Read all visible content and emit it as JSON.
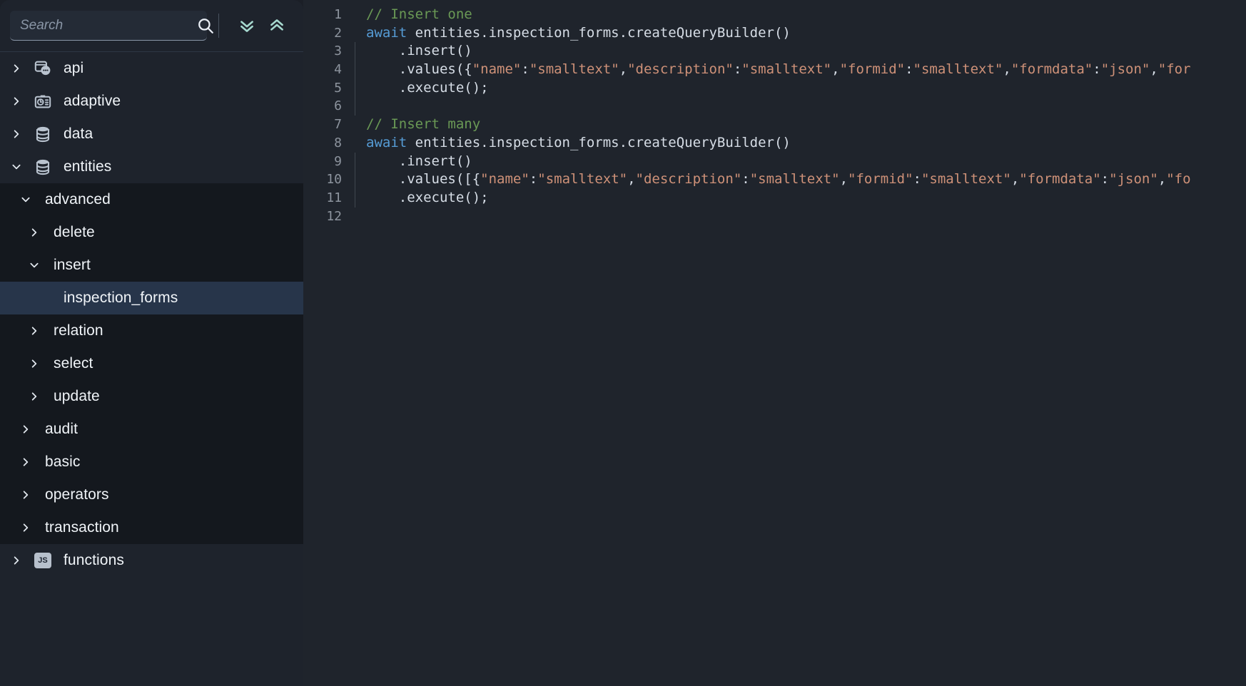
{
  "sidebar": {
    "search": {
      "placeholder": "Search",
      "value": "",
      "icon": "search-icon"
    },
    "expand_all_label": "Expand all",
    "collapse_all_label": "Collapse all",
    "tree": [
      {
        "label": "api",
        "depth": 0,
        "icon": "api-icon",
        "state": "collapsed",
        "selected": false
      },
      {
        "label": "adaptive",
        "depth": 0,
        "icon": "adaptive-icon",
        "state": "collapsed",
        "selected": false
      },
      {
        "label": "data",
        "depth": 0,
        "icon": "database-icon",
        "state": "collapsed",
        "selected": false
      },
      {
        "label": "entities",
        "depth": 0,
        "icon": "database-icon",
        "state": "expanded",
        "selected": false
      },
      {
        "label": "advanced",
        "depth": 1,
        "icon": "",
        "state": "expanded",
        "selected": false
      },
      {
        "label": "delete",
        "depth": 2,
        "icon": "",
        "state": "collapsed",
        "selected": false
      },
      {
        "label": "insert",
        "depth": 2,
        "icon": "",
        "state": "expanded",
        "selected": false
      },
      {
        "label": "inspection_forms",
        "depth": 3,
        "icon": "",
        "state": "leaf",
        "selected": true
      },
      {
        "label": "relation",
        "depth": 2,
        "icon": "",
        "state": "collapsed",
        "selected": false
      },
      {
        "label": "select",
        "depth": 2,
        "icon": "",
        "state": "collapsed",
        "selected": false
      },
      {
        "label": "update",
        "depth": 2,
        "icon": "",
        "state": "collapsed",
        "selected": false
      },
      {
        "label": "audit",
        "depth": 1,
        "icon": "",
        "state": "collapsed",
        "selected": false
      },
      {
        "label": "basic",
        "depth": 1,
        "icon": "",
        "state": "collapsed",
        "selected": false
      },
      {
        "label": "operators",
        "depth": 1,
        "icon": "",
        "state": "collapsed",
        "selected": false
      },
      {
        "label": "transaction",
        "depth": 1,
        "icon": "",
        "state": "collapsed",
        "selected": false
      },
      {
        "label": "functions",
        "depth": 0,
        "icon": "js-icon",
        "state": "collapsed",
        "selected": false
      }
    ]
  },
  "editor": {
    "lines": [
      {
        "num": "1",
        "indented": false,
        "tokens": [
          {
            "t": "comment",
            "s": "// Insert one"
          }
        ]
      },
      {
        "num": "2",
        "indented": false,
        "tokens": [
          {
            "t": "keyword",
            "s": "await"
          },
          {
            "t": "plain",
            "s": " entities.inspection_forms.createQueryBuilder()"
          }
        ]
      },
      {
        "num": "3",
        "indented": true,
        "tokens": [
          {
            "t": "plain",
            "s": "    .insert()"
          }
        ]
      },
      {
        "num": "4",
        "indented": true,
        "tokens": [
          {
            "t": "plain",
            "s": "    .values({"
          },
          {
            "t": "string",
            "s": "\"name\""
          },
          {
            "t": "plain",
            "s": ":"
          },
          {
            "t": "string",
            "s": "\"smalltext\""
          },
          {
            "t": "plain",
            "s": ","
          },
          {
            "t": "string",
            "s": "\"description\""
          },
          {
            "t": "plain",
            "s": ":"
          },
          {
            "t": "string",
            "s": "\"smalltext\""
          },
          {
            "t": "plain",
            "s": ","
          },
          {
            "t": "string",
            "s": "\"formid\""
          },
          {
            "t": "plain",
            "s": ":"
          },
          {
            "t": "string",
            "s": "\"smalltext\""
          },
          {
            "t": "plain",
            "s": ","
          },
          {
            "t": "string",
            "s": "\"formdata\""
          },
          {
            "t": "plain",
            "s": ":"
          },
          {
            "t": "string",
            "s": "\"json\""
          },
          {
            "t": "plain",
            "s": ","
          },
          {
            "t": "string",
            "s": "\"for"
          }
        ]
      },
      {
        "num": "5",
        "indented": true,
        "tokens": [
          {
            "t": "plain",
            "s": "    .execute();"
          }
        ]
      },
      {
        "num": "6",
        "indented": true,
        "tokens": [
          {
            "t": "plain",
            "s": ""
          }
        ]
      },
      {
        "num": "7",
        "indented": false,
        "tokens": [
          {
            "t": "comment",
            "s": "// Insert many"
          }
        ]
      },
      {
        "num": "8",
        "indented": false,
        "tokens": [
          {
            "t": "keyword",
            "s": "await"
          },
          {
            "t": "plain",
            "s": " entities.inspection_forms.createQueryBuilder()"
          }
        ]
      },
      {
        "num": "9",
        "indented": true,
        "tokens": [
          {
            "t": "plain",
            "s": "    .insert()"
          }
        ]
      },
      {
        "num": "10",
        "indented": true,
        "tokens": [
          {
            "t": "plain",
            "s": "    .values([{"
          },
          {
            "t": "string",
            "s": "\"name\""
          },
          {
            "t": "plain",
            "s": ":"
          },
          {
            "t": "string",
            "s": "\"smalltext\""
          },
          {
            "t": "plain",
            "s": ","
          },
          {
            "t": "string",
            "s": "\"description\""
          },
          {
            "t": "plain",
            "s": ":"
          },
          {
            "t": "string",
            "s": "\"smalltext\""
          },
          {
            "t": "plain",
            "s": ","
          },
          {
            "t": "string",
            "s": "\"formid\""
          },
          {
            "t": "plain",
            "s": ":"
          },
          {
            "t": "string",
            "s": "\"smalltext\""
          },
          {
            "t": "plain",
            "s": ","
          },
          {
            "t": "string",
            "s": "\"formdata\""
          },
          {
            "t": "plain",
            "s": ":"
          },
          {
            "t": "string",
            "s": "\"json\""
          },
          {
            "t": "plain",
            "s": ","
          },
          {
            "t": "string",
            "s": "\"fo"
          }
        ]
      },
      {
        "num": "11",
        "indented": true,
        "tokens": [
          {
            "t": "plain",
            "s": "    .execute();"
          }
        ]
      },
      {
        "num": "12",
        "indented": false,
        "tokens": [
          {
            "t": "plain",
            "s": ""
          }
        ]
      }
    ]
  },
  "colors": {
    "sidebar_bg": "#1e232c",
    "group_bg": "#14181e",
    "selection_bg": "#27354a",
    "editor_bg": "#1f242c",
    "accent_teal": "#a6d9cf",
    "comment": "#6a9955",
    "keyword": "#569cd6",
    "string": "#ce9178",
    "plain_text": "#d6dde6",
    "line_number": "#8d949e"
  }
}
